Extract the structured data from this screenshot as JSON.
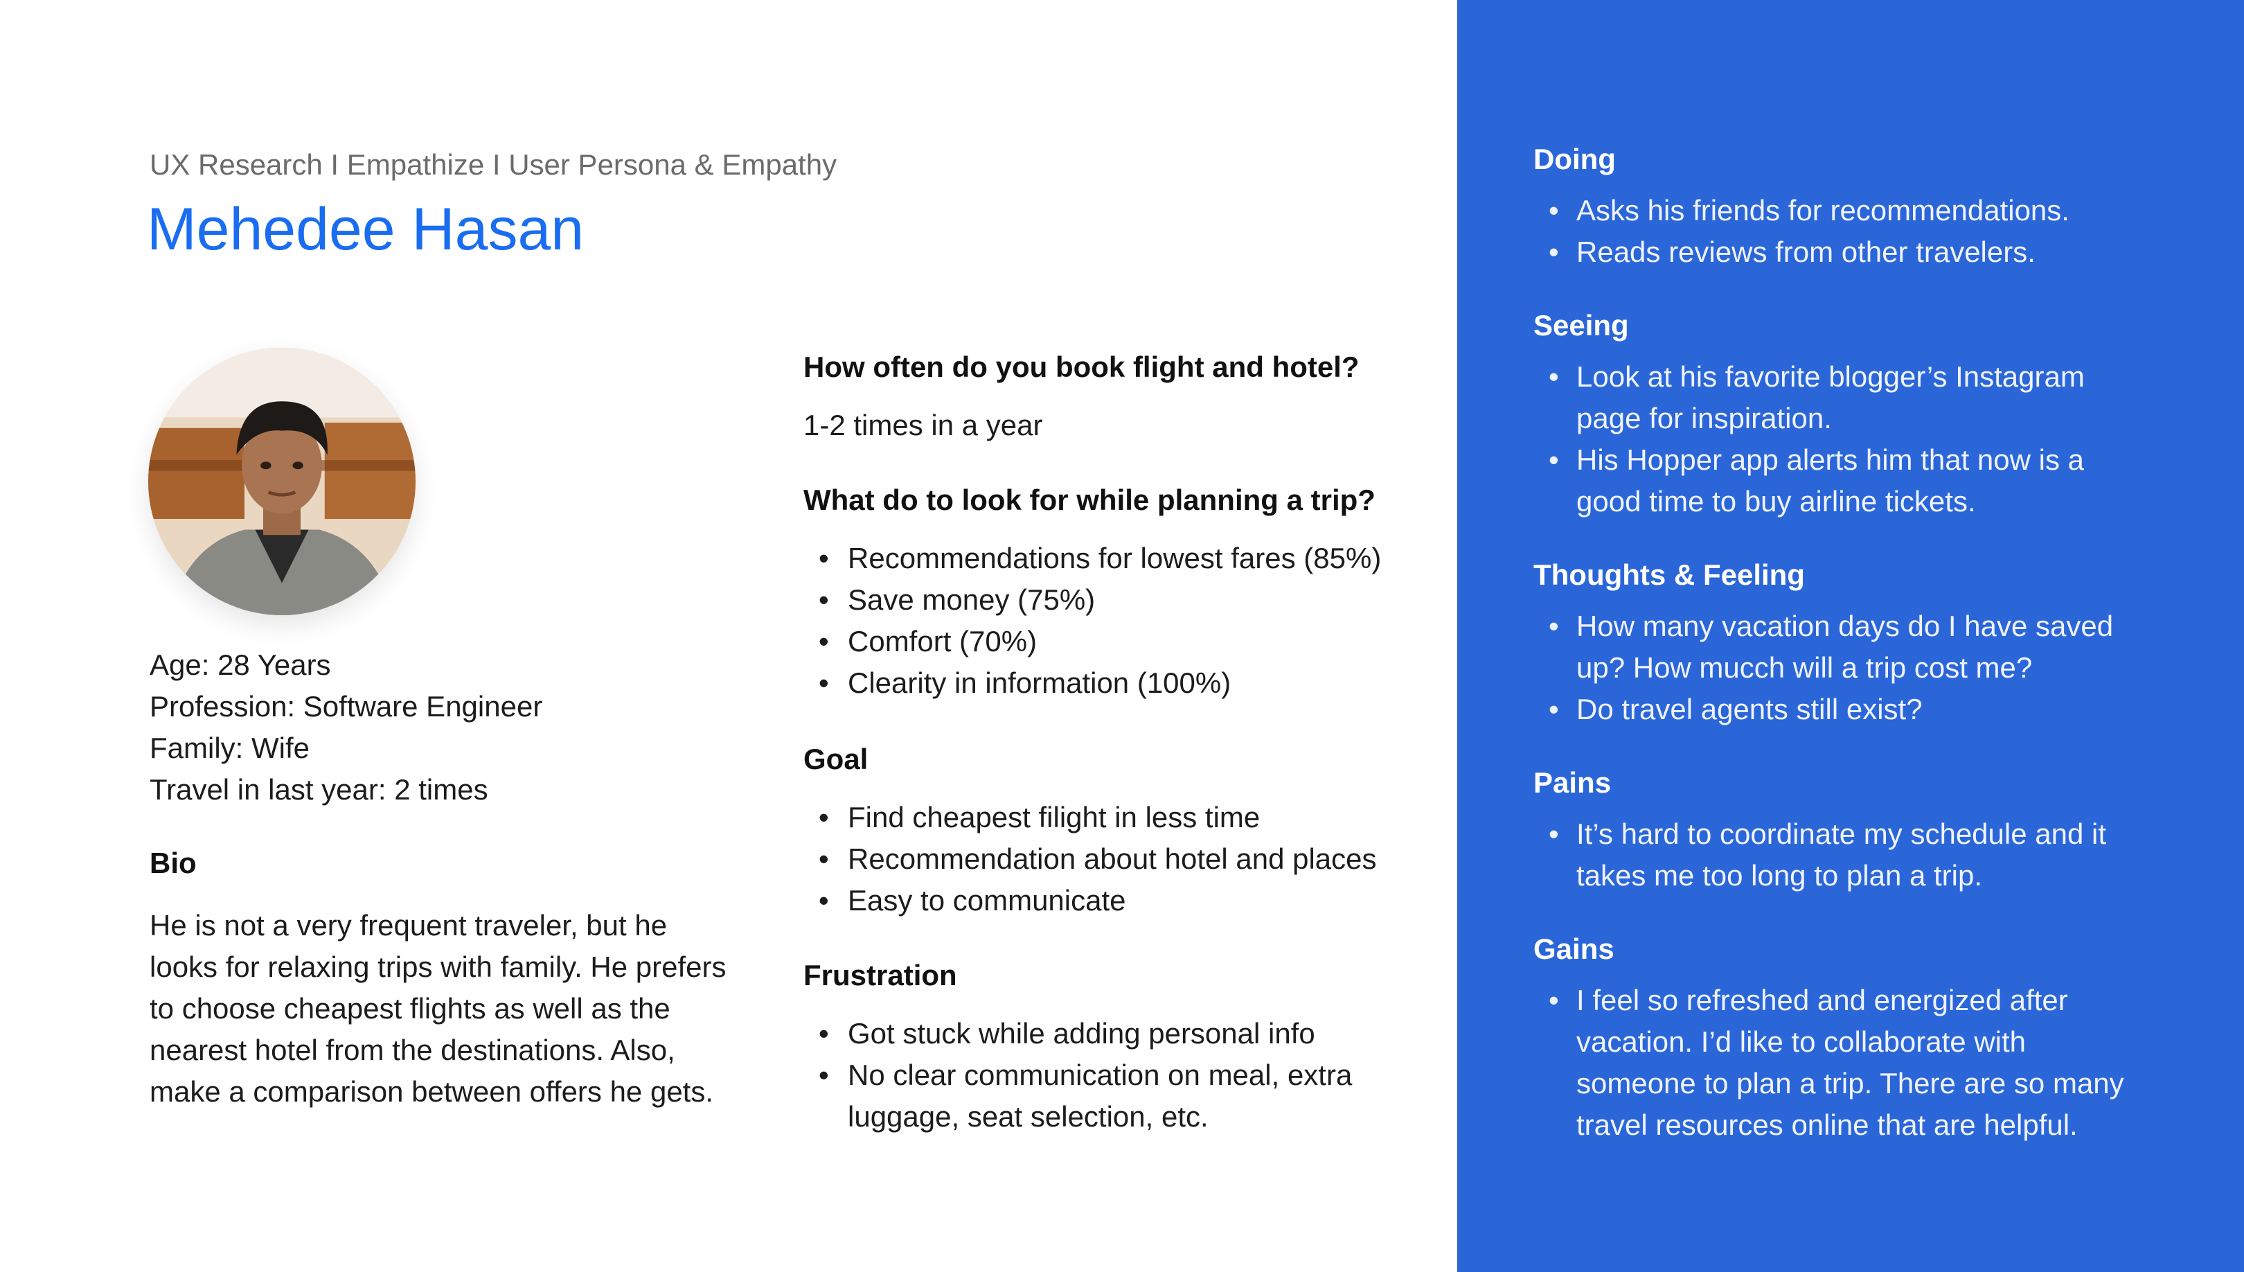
{
  "header": {
    "breadcrumb": "UX Research I Empathize I User Persona & Empathy",
    "name": "Mehedee Hasan"
  },
  "profile": {
    "age": "Age: 28 Years",
    "profession": "Profession: Software Engineer",
    "family": "Family: Wife",
    "travel": "Travel in last year: 2 times"
  },
  "bio": {
    "title": "Bio",
    "lines": [
      "He is not a very frequent traveler, but he",
      "looks for relaxing trips with family. He prefers",
      "to choose cheapest flights as well as the",
      "nearest hotel from the destinations. Also,",
      "make a comparison between offers he gets."
    ]
  },
  "survey": {
    "q1": "How often do you book flight and hotel?",
    "a1": "1-2 times in a year",
    "q2": "What do to look for while planning a trip?",
    "a2": [
      "Recommendations for lowest fares (85%)",
      "Save money (75%)",
      "Comfort (70%)",
      "Clearity in information (100%)"
    ],
    "goal_title": "Goal",
    "goals": [
      "Find cheapest filight in less time",
      "Recommendation about hotel and places",
      "Easy to communicate"
    ],
    "frustration_title": "Frustration",
    "frustrations": [
      [
        "Got stuck while adding personal info"
      ],
      [
        "No clear communication on meal, extra",
        "luggage, seat selection, etc."
      ]
    ]
  },
  "empathy": {
    "doing": {
      "title": "Doing",
      "items": [
        [
          "Asks his friends for recommendations."
        ],
        [
          "Reads reviews from other travelers."
        ]
      ]
    },
    "seeing": {
      "title": "Seeing",
      "items": [
        [
          "Look at his favorite blogger’s Instagram",
          "page for inspiration."
        ],
        [
          "His Hopper app alerts him that now is a",
          "good time to buy airline tickets."
        ]
      ]
    },
    "thoughts": {
      "title": "Thoughts & Feeling",
      "items": [
        [
          "How many vacation days do I have saved",
          "up? How mucch will a trip cost me?"
        ],
        [
          "Do travel agents still exist?"
        ]
      ]
    },
    "pains": {
      "title": "Pains",
      "items": [
        [
          "It’s hard to coordinate my schedule and it",
          "takes me too long to plan a trip."
        ]
      ]
    },
    "gains": {
      "title": "Gains",
      "items": [
        [
          "I feel so refreshed and energized after",
          "vacation. I’d like to collaborate with",
          "someone to plan a trip. There are so many",
          "travel resources online that are helpful."
        ]
      ]
    }
  },
  "colors": {
    "accent": "#1a6df0",
    "panel": "#2b66d8"
  }
}
